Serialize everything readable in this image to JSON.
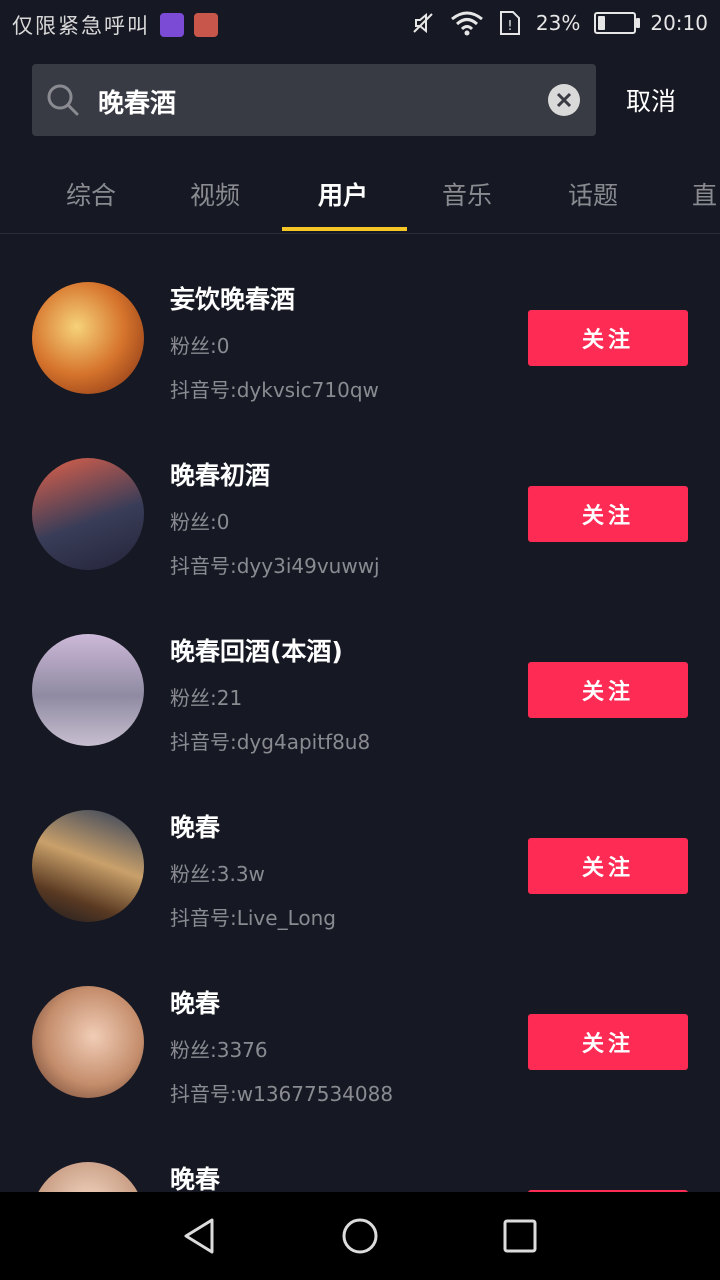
{
  "status_bar": {
    "carrier": "仅限紧急呼叫",
    "battery_percent": "23%",
    "battery_level": 0.23,
    "time": "20:10",
    "icons": [
      "gallery-notification-icon",
      "huawei-app-icon",
      "mute-icon",
      "wifi-icon",
      "sim-icon",
      "battery-icon"
    ]
  },
  "search": {
    "query": "晚春酒",
    "cancel_label": "取消"
  },
  "tabs": {
    "items": [
      "综合",
      "视频",
      "用户",
      "音乐",
      "话题",
      "直"
    ],
    "active": "用户"
  },
  "users": [
    {
      "name": "妄饮晚春酒",
      "fans": "粉丝:0",
      "douyin_id": "抖音号:dykvsic710qw",
      "follow_label": "关注"
    },
    {
      "name": "晚春初酒",
      "fans": "粉丝:0",
      "douyin_id": "抖音号:dyy3i49vuwwj",
      "follow_label": "关注"
    },
    {
      "name": "晚春回酒(本酒)",
      "fans": "粉丝:21",
      "douyin_id": "抖音号:dyg4apitf8u8",
      "follow_label": "关注"
    },
    {
      "name": "晚春",
      "fans": "粉丝:3.3w",
      "douyin_id": "抖音号:Live_Long",
      "follow_label": "关注"
    },
    {
      "name": "晚春",
      "fans": "粉丝:3376",
      "douyin_id": "抖音号:w13677534088",
      "follow_label": "关注"
    },
    {
      "name": "晚春",
      "fans": "",
      "douyin_id": "",
      "follow_label": ""
    }
  ],
  "colors": {
    "background": "#161823",
    "follow_button": "#fe2c55",
    "tab_indicator": "#f5c626",
    "secondary_text": "#8a8b91"
  },
  "nav": {
    "icons": [
      "back-icon",
      "home-icon",
      "recents-icon"
    ]
  }
}
